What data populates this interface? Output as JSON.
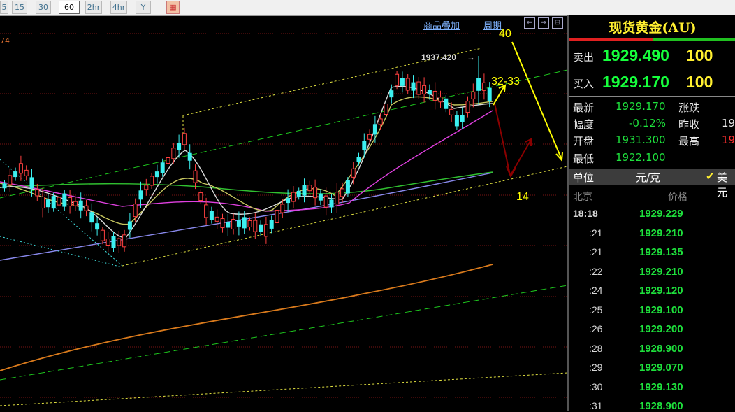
{
  "toolbar": {
    "buttons": [
      {
        "label": "5"
      },
      {
        "label": "15"
      },
      {
        "label": "30"
      },
      {
        "label": "60"
      },
      {
        "label": "2hr"
      },
      {
        "label": "4hr"
      },
      {
        "label": "Y"
      }
    ],
    "active": "60"
  },
  "chart": {
    "links": {
      "overlay": "商品叠加",
      "period": "周期"
    },
    "corner_label": "74",
    "high_marker": "1937.420",
    "annotations": {
      "target_high": "40",
      "resistance": "32-33",
      "target_low": "14"
    }
  },
  "panel": {
    "title": "现货黄金(AU)",
    "sell": {
      "label": "卖出",
      "price": "1929.490",
      "qty": "100"
    },
    "buy": {
      "label": "买入",
      "price": "1929.170",
      "qty": "100"
    },
    "stats": {
      "latest_label": "最新",
      "latest_value": "1929.170",
      "change_label": "涨跌",
      "pct_label": "幅度",
      "pct_value": "-0.12%",
      "prev_label": "昨收",
      "prev_value": "19",
      "open_label": "开盘",
      "open_value": "1931.300",
      "high_label": "最高",
      "high_value": "19",
      "low_label": "最低",
      "low_value": "1922.100"
    },
    "unit": {
      "label": "单位",
      "value": "元/克",
      "currency": "美元"
    },
    "ticks_header": {
      "time": "北京",
      "price": "价格"
    },
    "ticks": [
      {
        "time": "18:18",
        "price": "1929.229"
      },
      {
        "time": ":21",
        "price": "1929.210"
      },
      {
        "time": ":21",
        "price": "1929.135"
      },
      {
        "time": ":22",
        "price": "1929.210"
      },
      {
        "time": ":24",
        "price": "1929.120"
      },
      {
        "time": ":25",
        "price": "1929.100"
      },
      {
        "time": ":26",
        "price": "1929.200"
      },
      {
        "time": ":28",
        "price": "1928.900"
      },
      {
        "time": ":29",
        "price": "1929.070"
      },
      {
        "time": ":30",
        "price": "1929.130"
      },
      {
        "time": ":31",
        "price": "1928.900"
      }
    ]
  }
}
